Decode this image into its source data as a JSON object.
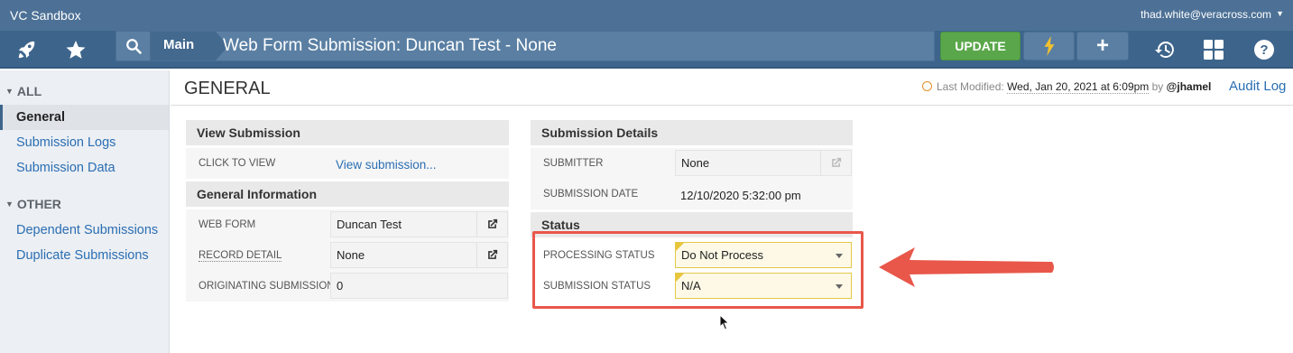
{
  "topbar": {
    "app_name": "VC Sandbox",
    "user": "thad.white@veracross.com"
  },
  "nav": {
    "main_crumb": "Main",
    "page_title": "Web Form Submission: Duncan Test - None",
    "update_label": "UPDATE",
    "plus_label": "+"
  },
  "sidebar": {
    "section_all": "ALL",
    "section_other": "OTHER",
    "items_all": [
      "General",
      "Submission Logs",
      "Submission Data"
    ],
    "items_other": [
      "Dependent Submissions",
      "Duplicate Submissions"
    ]
  },
  "header": {
    "title": "GENERAL",
    "last_modified_label": "Last Modified:",
    "last_modified_date": "Wed, Jan 20, 2021 at 6:09pm",
    "by_label": "by",
    "by_user": "@jhamel",
    "audit_log": "Audit Log"
  },
  "view_submission": {
    "title": "View Submission",
    "click_label": "CLICK TO VIEW",
    "link_text": "View submission..."
  },
  "general_info": {
    "title": "General Information",
    "web_form_label": "WEB FORM",
    "web_form_value": "Duncan Test",
    "record_detail_label": "RECORD DETAIL",
    "record_detail_value": "None",
    "originating_label": "ORIGINATING SUBMISSION",
    "originating_value": "0"
  },
  "submission_details": {
    "title": "Submission Details",
    "submitter_label": "SUBMITTER",
    "submitter_value": "None",
    "date_label": "SUBMISSION DATE",
    "date_value": "12/10/2020 5:32:00 pm"
  },
  "status": {
    "title": "Status",
    "processing_label": "PROCESSING STATUS",
    "processing_value": "Do Not Process",
    "submission_label": "SUBMISSION STATUS",
    "submission_value": "N/A"
  },
  "colors": {
    "nav": "#3d658c",
    "update": "#5aa74b",
    "link": "#2a6eb3",
    "highlight": "#e8574a"
  }
}
